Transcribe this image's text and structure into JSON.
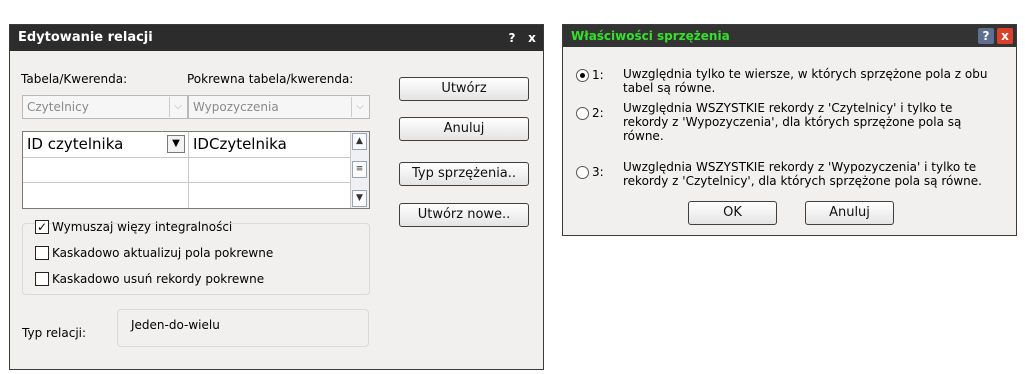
{
  "relations_dialog": {
    "title": "Edytowanie relacji",
    "help_button": "?",
    "close_button": "x",
    "table_label": "Tabela/Kwerenda:",
    "related_table_label": "Pokrewna tabela/kwerenda:",
    "table_value": "Czytelnicy",
    "related_table_value": "Wypozyczenia",
    "field_rows": [
      {
        "left": "ID czytelnika",
        "right": "IDCzytelnika"
      },
      {
        "left": "",
        "right": ""
      },
      {
        "left": "",
        "right": ""
      }
    ],
    "buttons": {
      "create": "Utwórz",
      "cancel": "Anuluj",
      "join_type": "Typ sprzężenia..",
      "create_new": "Utwórz nowe.."
    },
    "checkboxes": [
      {
        "label": "Wymuszaj więzy integralności",
        "checked": true
      },
      {
        "label": "Kaskadowo aktualizuj pola pokrewne",
        "checked": false
      },
      {
        "label": "Kaskadowo usuń rekordy pokrewne",
        "checked": false
      }
    ],
    "relation_type_label": "Typ relacji:",
    "relation_type_value": "Jeden-do-wielu"
  },
  "join_dialog": {
    "title": "Właściwości sprzężenia",
    "help_button": "?",
    "close_button": "x",
    "options": [
      {
        "num": "1:",
        "selected": true,
        "lines": [
          "Uwzględnia tylko te wiersze, w których sprzężone pola z obu",
          "tabel są równe."
        ]
      },
      {
        "num": "2:",
        "selected": false,
        "lines": [
          "Uwzględnia WSZYSTKIE rekordy z 'Czytelnicy' i tylko te",
          "rekordy z 'Wypozyczenia', dla których sprzężone pola są",
          "równe."
        ]
      },
      {
        "num": "3:",
        "selected": false,
        "lines": [
          "Uwzględnia WSZYSTKIE rekordy z 'Wypozyczenia' i tylko te",
          "rekordy z 'Czytelnicy', dla których sprzężone pola są równe."
        ]
      }
    ],
    "ok": "OK",
    "cancel": "Anuluj"
  },
  "colors": {
    "title_bar": "#2c2c2c",
    "join_title_text": "#35e02a",
    "close_button_red": "#d9412a"
  }
}
